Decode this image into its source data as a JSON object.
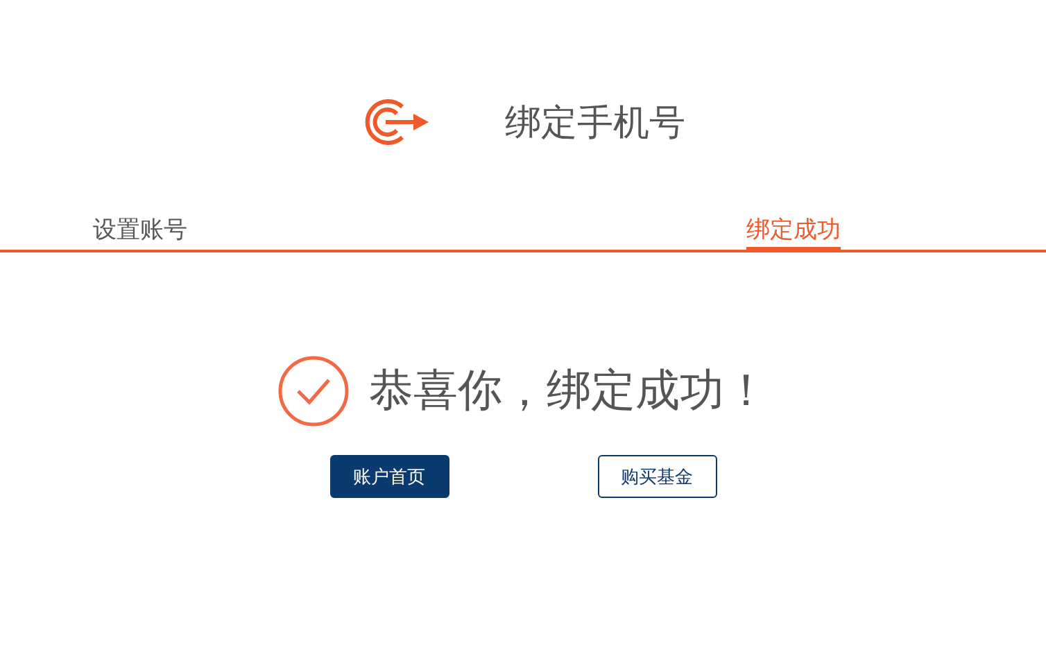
{
  "header": {
    "title": "绑定手机号"
  },
  "steps": [
    {
      "label": "设置账号",
      "selected": false
    },
    {
      "label": "绑定成功",
      "selected": true
    }
  ],
  "result": {
    "message": "恭喜你，绑定成功！"
  },
  "buttons": [
    {
      "label": "账户首页",
      "kind": "primary"
    },
    {
      "label": "购买基金",
      "kind": "outline"
    }
  ]
}
